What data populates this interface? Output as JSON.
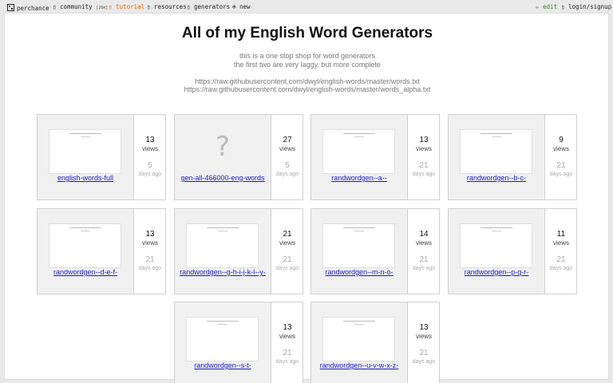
{
  "nav": {
    "logo": "perchance",
    "community": "community",
    "community_count": "[26m]",
    "tutorial": "tutorial",
    "resources": "resources",
    "generators": "generators",
    "new": "new",
    "edit": "edit",
    "login": "login/signup"
  },
  "page": {
    "title": "All of my English Word Generators",
    "sub1": "this is a one stop shop for word generators",
    "sub2": "the first two are very laggy, but more complete",
    "link1": "https://raw.githubusercontent.com/dwyl/english-words/master/words.txt",
    "link2": "https://raw.githubusercontent.com/dwyl/english-words/master/words_alpha.txt"
  },
  "cards": [
    {
      "name": "english-words-full",
      "views": "13",
      "views_label": "views",
      "days": "5",
      "days_label": "days ago",
      "thumb": true
    },
    {
      "name": "gen-all-466000-eng-words",
      "views": "27",
      "views_label": "views",
      "days": "5",
      "days_label": "days ago",
      "thumb": false,
      "placeholder": "?"
    },
    {
      "name": "randwordgen--a--",
      "views": "13",
      "views_label": "views",
      "days": "21",
      "days_label": "days ago",
      "thumb": true
    },
    {
      "name": "randwordgen--b-c-",
      "views": "9",
      "views_label": "views",
      "days": "21",
      "days_label": "days ago",
      "thumb": true
    },
    {
      "name": "randwordgen--d-e-f-",
      "views": "13",
      "views_label": "views",
      "days": "21",
      "days_label": "days ago",
      "thumb": true
    },
    {
      "name": "randwordgen--g-h-i-j-k-l--y-",
      "views": "21",
      "views_label": "views",
      "days": "21",
      "days_label": "days ago",
      "thumb": true
    },
    {
      "name": "randwordgen--m-n-o-",
      "views": "14",
      "views_label": "views",
      "days": "21",
      "days_label": "days ago",
      "thumb": true
    },
    {
      "name": "randwordgen--p-q-r-",
      "views": "11",
      "views_label": "views",
      "days": "21",
      "days_label": "days ago",
      "thumb": true
    },
    {
      "name": "randwordgen--s-t-",
      "views": "13",
      "views_label": "views",
      "days": "21",
      "days_label": "days ago",
      "thumb": true
    },
    {
      "name": "randwordgen--u-v-w-x-z-",
      "views": "13",
      "views_label": "views",
      "days": "21",
      "days_label": "days ago",
      "thumb": true
    }
  ]
}
